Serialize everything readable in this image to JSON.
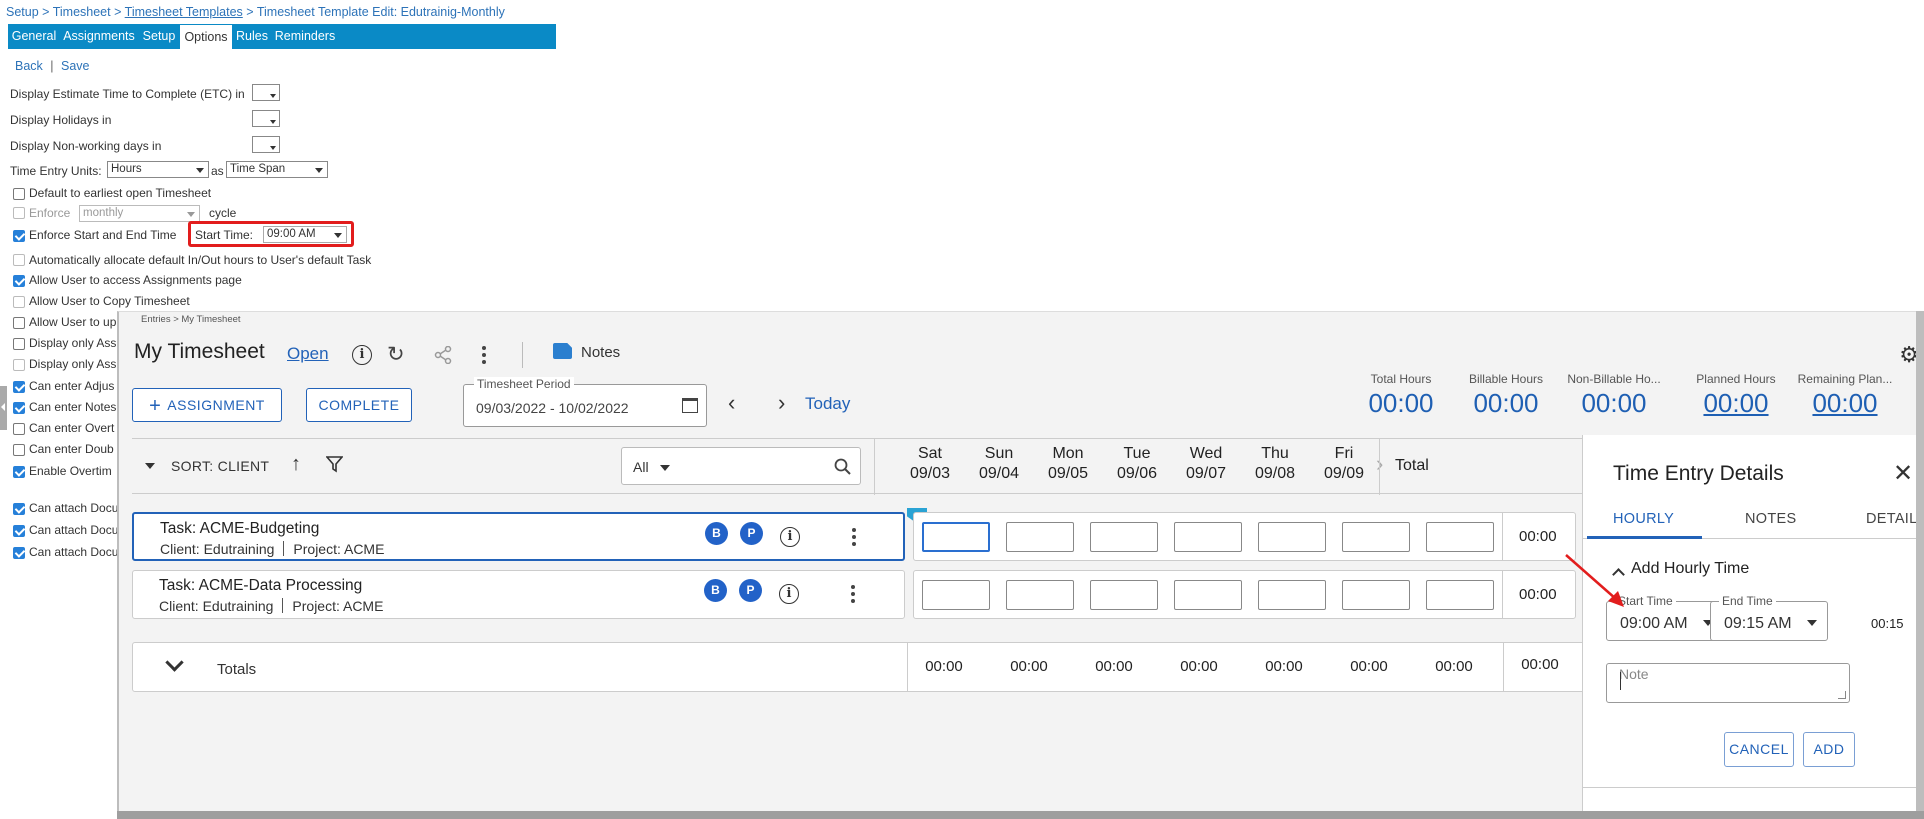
{
  "setup": {
    "breadcrumb": {
      "root": "Setup",
      "sep1": ">",
      "timesheet": "Timesheet",
      "sep2": ">",
      "templates": "Timesheet Templates",
      "sep3": ">",
      "current": "Timesheet Template Edit: Edutrainig-Monthly"
    },
    "tabs": [
      "General",
      "Assignments",
      "Setup",
      "Options",
      "Rules",
      "Reminders"
    ],
    "active_tab": "Options",
    "links": {
      "back": "Back",
      "sep": "|",
      "save": "Save"
    },
    "rows": {
      "etc": "Display Estimate Time to Complete (ETC) in",
      "holidays": "Display Holidays in",
      "nonworking": "Display Non-working days in",
      "units_label": "Time Entry Units:",
      "units_value": "Hours",
      "as": "as",
      "span_value": "Time Span"
    },
    "checks": [
      {
        "label": "Default to earliest open Timesheet",
        "checked": false,
        "disabled": false
      },
      {
        "label": "Enforce",
        "checked": false,
        "disabled": true
      },
      {
        "label": "Enforce Start and End Time",
        "checked": true,
        "disabled": false
      },
      {
        "label": "Automatically allocate default In/Out hours to User's default Task",
        "checked": false,
        "disabled": true
      },
      {
        "label": "Allow User to access Assignments page",
        "checked": true,
        "disabled": false
      },
      {
        "label": "Allow User to Copy Timesheet",
        "checked": false,
        "disabled": true
      },
      {
        "label": "Allow User to up",
        "checked": false,
        "disabled": false
      },
      {
        "label": "Display only Ass",
        "checked": false,
        "disabled": false
      },
      {
        "label": "Display only Ass",
        "checked": false,
        "disabled": true
      },
      {
        "label": "Can enter Adjus",
        "checked": true,
        "disabled": false
      },
      {
        "label": "Can enter Notes",
        "checked": true,
        "disabled": false
      },
      {
        "label": "Can enter Overt",
        "checked": false,
        "disabled": false
      },
      {
        "label": "Can enter Doub",
        "checked": false,
        "disabled": false
      },
      {
        "label": "Enable Overtim",
        "checked": true,
        "disabled": false
      },
      {
        "label": "Can attach Docu",
        "checked": true,
        "disabled": false
      },
      {
        "label": "Can attach Docu",
        "checked": true,
        "disabled": false
      },
      {
        "label": "Can attach Docu",
        "checked": true,
        "disabled": false
      }
    ],
    "enforce_cycle_value": "monthly",
    "cycle": "cycle",
    "start_time_label": "Start Time:",
    "start_time_value": "09:00 AM"
  },
  "timesheet": {
    "breadcrumb": "Entries > My Timesheet",
    "title": "My Timesheet",
    "status": "Open",
    "notes_label": "Notes",
    "assignment_button": "ASSIGNMENT",
    "assignment_plus": "+",
    "complete_button": "COMPLETE",
    "period_label": "Timesheet Period",
    "period_value": "09/03/2022 - 10/02/2022",
    "today": "Today",
    "stats": [
      {
        "label": "Total Hours",
        "value": "00:00",
        "link": false
      },
      {
        "label": "Billable Hours",
        "value": "00:00",
        "link": false
      },
      {
        "label": "Non-Billable Ho...",
        "value": "00:00",
        "link": false
      },
      {
        "label": "Planned Hours",
        "value": "00:00",
        "link": true
      },
      {
        "label": "Remaining Plan...",
        "value": "00:00",
        "link": true
      }
    ],
    "sort_label": "SORT: CLIENT",
    "filter_value": "All",
    "days": [
      {
        "dow": "Sat",
        "date": "09/03"
      },
      {
        "dow": "Sun",
        "date": "09/04"
      },
      {
        "dow": "Mon",
        "date": "09/05"
      },
      {
        "dow": "Tue",
        "date": "09/06"
      },
      {
        "dow": "Wed",
        "date": "09/07"
      },
      {
        "dow": "Thu",
        "date": "09/08"
      },
      {
        "dow": "Fri",
        "date": "09/09"
      }
    ],
    "total_header": "Total",
    "tasks": [
      {
        "task": "Task: ACME-Budgeting",
        "client": "Client: Edutraining",
        "project": "Project: ACME",
        "badge1": "B",
        "badge2": "P",
        "total": "00:00"
      },
      {
        "task": "Task: ACME-Data Processing",
        "client": "Client: Edutraining",
        "project": "Project: ACME",
        "badge1": "B",
        "badge2": "P",
        "total": "00:00"
      }
    ],
    "totals_label": "Totals",
    "totals": [
      "00:00",
      "00:00",
      "00:00",
      "00:00",
      "00:00",
      "00:00",
      "00:00"
    ],
    "grand_total": "00:00"
  },
  "details": {
    "title": "Time Entry Details",
    "tabs": [
      "HOURLY",
      "NOTES",
      "DETAILS"
    ],
    "section": "Add Hourly Time",
    "start_label": "Start Time",
    "start_value": "09:00 AM",
    "end_label": "End Time",
    "end_value": "09:15 AM",
    "duration": "00:15",
    "note_placeholder": "Note",
    "cancel": "CANCEL",
    "add": "ADD"
  },
  "colors": {
    "tab_bar": "#0a8ac6",
    "primary": "#2262b8",
    "highlight": "#e21d1d",
    "badge": "#2262c8"
  }
}
